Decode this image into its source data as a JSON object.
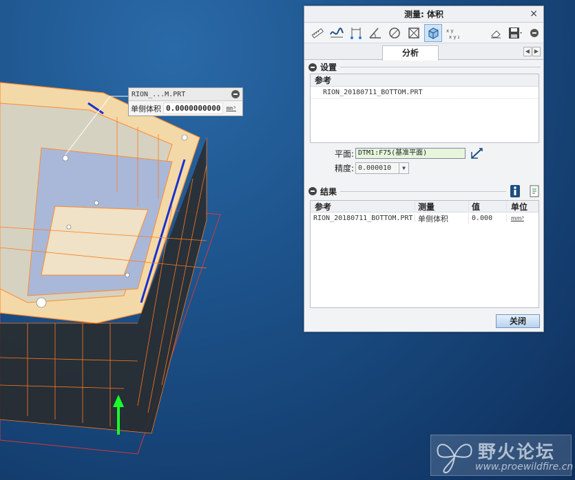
{
  "callout": {
    "title": "RION_...M.PRT",
    "label": "单侧体积",
    "value": "0.0000000000",
    "unit": "mm³"
  },
  "dialog": {
    "title": "测量: 体积",
    "close_glyph": "×",
    "tab": "分析",
    "toolbar_icons": [
      "length-icon",
      "curve-length-icon",
      "distance-icon",
      "angle-icon",
      "diameter-icon",
      "area-icon",
      "volume-icon",
      "transform-icon",
      "eraser-icon",
      "save-icon",
      "collapse-icon"
    ],
    "settings": {
      "heading": "设置",
      "ref_header": "参考",
      "references": [
        "RION_20180711_BOTTOM.PRT"
      ],
      "plane_label": "平面:",
      "plane_value": "DTM1:F75(基准平面)",
      "precision_label": "精度:",
      "precision_value": "0.000010"
    },
    "results": {
      "heading": "结果",
      "columns": [
        "参考",
        "测量",
        "值",
        "单位"
      ],
      "rows": [
        {
          "ref": "RION_20180711_BOTTOM.PRT",
          "measure": "单侧体积",
          "value": "0.000",
          "unit": "mm³"
        }
      ]
    },
    "close_button": "关闭"
  },
  "watermark": {
    "text": "野火论坛",
    "url": "www.proewildfire.cn"
  },
  "colors": {
    "background": "#1b4f86",
    "model_edges": "#ff7a1a",
    "accent_blue": "#1d4e7e"
  }
}
